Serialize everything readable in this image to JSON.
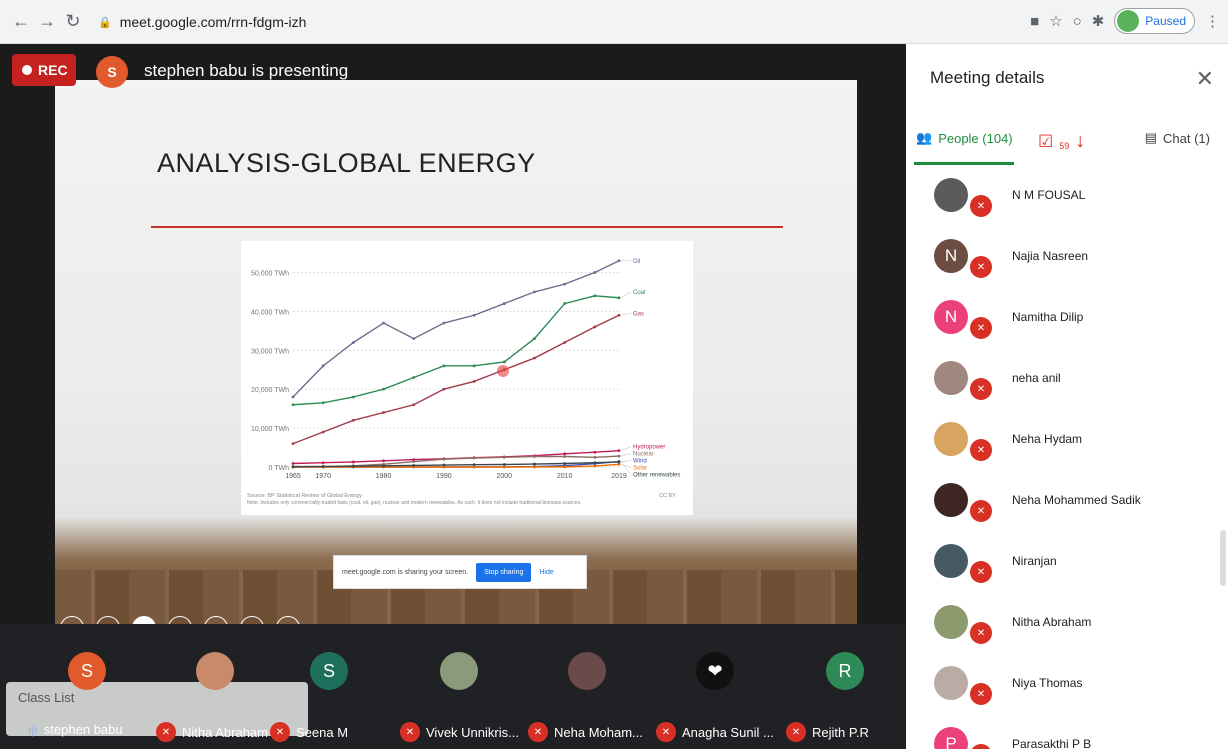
{
  "browser": {
    "url": "meet.google.com/rrn-fdgm-izh",
    "profile_status": "Paused",
    "colors": {
      "bar": "#f1f3f4"
    }
  },
  "stage": {
    "rec_label": "REC",
    "presenter_initial": "S",
    "presenting_text": "stephen babu is presenting"
  },
  "slide": {
    "title": "ANALYSIS-GLOBAL ENERGY",
    "share_notice": "meet.google.com is sharing your screen.",
    "stop_sharing_label": "Stop sharing",
    "hide_label": "Hide"
  },
  "chart_data": {
    "type": "line",
    "x": [
      1965,
      1970,
      1975,
      1980,
      1985,
      1990,
      1995,
      2000,
      2005,
      2010,
      2015,
      2019
    ],
    "xticks": [
      "1965",
      "1970",
      "1980",
      "1990",
      "2000",
      "2010",
      "2019"
    ],
    "yticks": [
      "0 TWh",
      "10,000 TWh",
      "20,000 TWh",
      "30,000 TWh",
      "40,000 TWh",
      "50,000 TWh"
    ],
    "ylim": [
      0,
      55000
    ],
    "series": [
      {
        "name": "Oil",
        "color": "#6a6f8c",
        "values": [
          18000,
          26000,
          32000,
          37000,
          33000,
          37000,
          39000,
          42000,
          45000,
          47000,
          50000,
          53000
        ]
      },
      {
        "name": "Coal",
        "color": "#2e8b57",
        "values": [
          16000,
          16500,
          18000,
          20000,
          23000,
          26000,
          26000,
          27000,
          33000,
          42000,
          44000,
          43500
        ]
      },
      {
        "name": "Gas",
        "color": "#a23b4a",
        "values": [
          6000,
          9000,
          12000,
          14000,
          16000,
          20000,
          22000,
          25000,
          28000,
          32000,
          36000,
          39000
        ]
      },
      {
        "name": "Hydropower",
        "color": "#c2185b",
        "values": [
          900,
          1100,
          1300,
          1600,
          1900,
          2100,
          2400,
          2600,
          2900,
          3400,
          3800,
          4200
        ]
      },
      {
        "name": "Nuclear",
        "color": "#8d6e63",
        "values": [
          0,
          50,
          300,
          700,
          1400,
          2000,
          2300,
          2500,
          2700,
          2700,
          2500,
          2800
        ]
      },
      {
        "name": "Wind",
        "color": "#3f51b5",
        "values": [
          0,
          0,
          0,
          0,
          0,
          0,
          0,
          30,
          100,
          350,
          850,
          1400
        ]
      },
      {
        "name": "Solar",
        "color": "#ef6c00",
        "values": [
          0,
          0,
          0,
          0,
          0,
          0,
          0,
          0,
          5,
          35,
          250,
          700
        ]
      },
      {
        "name": "Other renewables",
        "color": "#37474f",
        "values": [
          100,
          150,
          200,
          300,
          400,
          500,
          600,
          650,
          750,
          900,
          1100,
          1300
        ]
      }
    ],
    "source": "Source: BP Statistical Review of Global Energy",
    "note": "Note: Includes only commercially-traded fuels (coal, oil, gas), nuclear and modern renewables. As such, it does not include traditional biomass sources.",
    "license": "CC BY"
  },
  "strip": {
    "class_list_label": "Class List",
    "tiles": [
      {
        "initial": "S",
        "color": "#e15a2b",
        "name": "stephen babu"
      },
      {
        "initial": "",
        "color": "#c98a6a",
        "name": "Nitha Abraham"
      },
      {
        "initial": "S",
        "color": "#1e6f5c",
        "name": "Seena M"
      },
      {
        "initial": "",
        "color": "#8a9a7a",
        "name": "Vivek Unnikris..."
      },
      {
        "initial": "",
        "color": "#6b4a4a",
        "name": "Neha Moham..."
      },
      {
        "initial": "❤",
        "color": "#111111",
        "name": "Anagha Sunil ..."
      },
      {
        "initial": "R",
        "color": "#2e8b57",
        "name": "Rejith P.R"
      }
    ]
  },
  "panel": {
    "title": "Meeting details",
    "tab_people": "People (104)",
    "tab_tasks_count": "59",
    "tab_chat": "Chat (1)",
    "people": [
      {
        "initial": "",
        "color": "#5b5b5b",
        "name": "N M FOUSAL"
      },
      {
        "initial": "N",
        "color": "#6d4c41",
        "name": "Najia Nasreen"
      },
      {
        "initial": "N",
        "color": "#ec407a",
        "name": "Namitha Dilip"
      },
      {
        "initial": "",
        "color": "#a1887f",
        "name": "neha anil"
      },
      {
        "initial": "",
        "color": "#d7a560",
        "name": "Neha Hydam"
      },
      {
        "initial": "",
        "color": "#3e2723",
        "name": "Neha Mohammed Sadik"
      },
      {
        "initial": "",
        "color": "#455a64",
        "name": "Niranjan"
      },
      {
        "initial": "",
        "color": "#8d9a6e",
        "name": "Nitha Abraham"
      },
      {
        "initial": "",
        "color": "#bcaaa4",
        "name": "Niya Thomas"
      },
      {
        "initial": "P",
        "color": "#ec407a",
        "name": "Parasakthi P B"
      }
    ]
  }
}
